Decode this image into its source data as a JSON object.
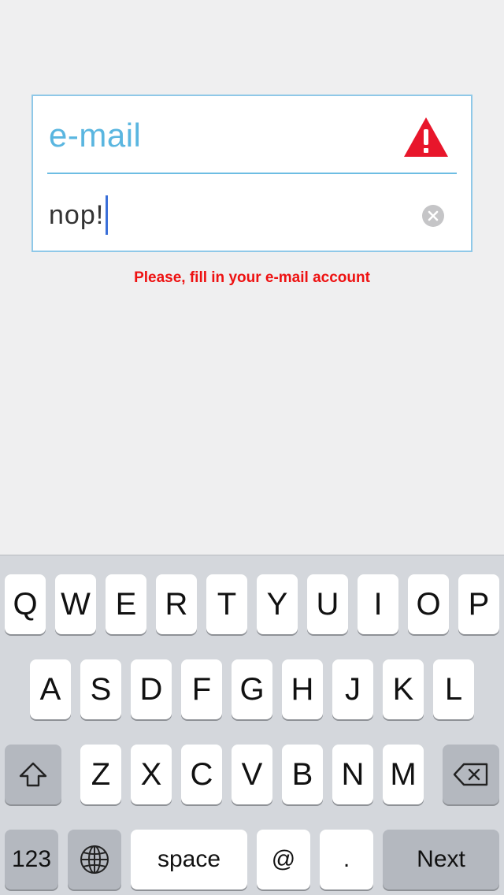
{
  "form": {
    "title": "e-mail",
    "input_value": "nop!",
    "error_message": "Please, fill in your e-mail account",
    "warning_color": "#e8162b",
    "accent_color": "#5ab6e0"
  },
  "keyboard": {
    "row1": [
      "Q",
      "W",
      "E",
      "R",
      "T",
      "Y",
      "U",
      "I",
      "O",
      "P"
    ],
    "row2": [
      "A",
      "S",
      "D",
      "F",
      "G",
      "H",
      "J",
      "K",
      "L"
    ],
    "row3": [
      "Z",
      "X",
      "C",
      "V",
      "B",
      "N",
      "M"
    ],
    "numbers_label": "123",
    "space_label": "space",
    "at_label": "@",
    "period_label": ".",
    "next_label": "Next",
    "icons": {
      "shift": "shift-icon",
      "delete": "backspace-icon",
      "globe": "globe-icon"
    }
  }
}
